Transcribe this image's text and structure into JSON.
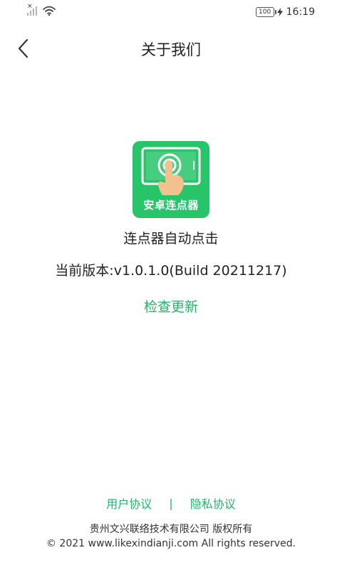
{
  "status_bar": {
    "time": "16:19",
    "battery_level": "100",
    "icons": [
      "signal-icon",
      "wifi-icon",
      "battery-icon",
      "charging-icon"
    ]
  },
  "header": {
    "title": "关于我们",
    "back_icon": "chevron-left-icon"
  },
  "app": {
    "logo_text": "安卓连点器",
    "name": "连点器自动点击",
    "version": "当前版本:v1.0.1.0(Build 20211217)",
    "check_update_label": "检查更新",
    "brand_color": "#27c46a",
    "accent_color": "#22b46a"
  },
  "footer": {
    "user_agreement": "用户协议",
    "separator": "|",
    "privacy_policy": "隐私协议",
    "company": "贵州文兴联络技术有限公司 版权所有",
    "copyright": "© 2021 www.likexindianji.com All rights reserved."
  }
}
